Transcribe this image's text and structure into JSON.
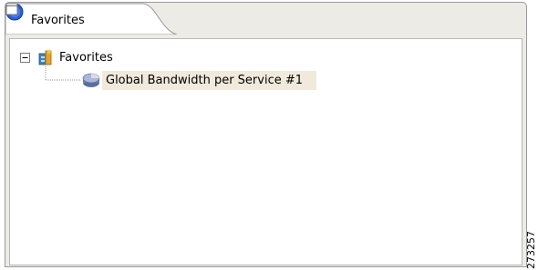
{
  "tab": {
    "label": "Favorites",
    "icon": "star-icon",
    "close_icon": "close-icon"
  },
  "toolbar": {
    "run_icon": "play-circle-icon",
    "menu_icon": "view-menu-triangle-icon",
    "minimize_icon": "minimize-icon",
    "maximize_icon": "maximize-icon"
  },
  "tree": {
    "root": {
      "label": "Favorites",
      "icon": "favorites-folder-icon",
      "expander_icon": "collapse-minus-icon"
    },
    "children": [
      {
        "label": "Global Bandwidth per Service #1",
        "icon": "report-cylinder-icon"
      }
    ]
  },
  "figure_id": "273257",
  "colors": {
    "accent": "#2b5fd9",
    "tab_bg": "#ffffff",
    "view_bg": "#ecebe6",
    "selection_bg": "#f1eadc"
  }
}
